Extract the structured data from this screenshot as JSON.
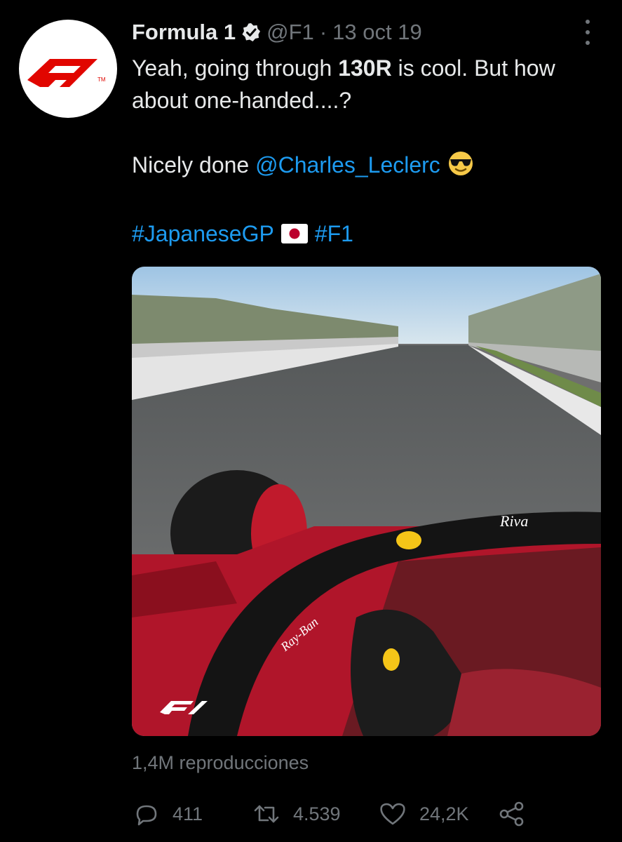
{
  "tweet": {
    "author_name": "Formula 1",
    "handle": "@F1",
    "separator": "·",
    "date": "13 oct 19",
    "line1_pre": "Yeah, going through ",
    "line1_bold": "130R",
    "line1_post": " is cool. But how about one-handed....?",
    "line2_pre": "Nicely done ",
    "mention": "@Charles_Leclerc",
    "hashtag1": "#JapaneseGP",
    "hashtag2": "#F1",
    "views": "1,4M reproducciones"
  },
  "actions": {
    "replies": "411",
    "retweets": "4.539",
    "likes": "24,2K"
  },
  "icons": [
    "f1-logo-icon",
    "verified-badge-icon",
    "more-options-icon",
    "sunglasses-emoji-icon",
    "japan-flag-icon",
    "reply-icon",
    "retweet-icon",
    "like-icon",
    "share-icon"
  ],
  "colors": {
    "background": "#000000",
    "text": "#e7e9ea",
    "secondary": "#71767b",
    "link": "#1d9bf0",
    "f1_red": "#e10600"
  }
}
